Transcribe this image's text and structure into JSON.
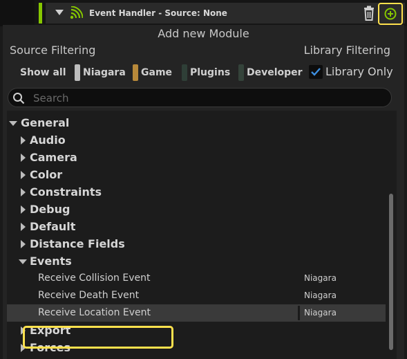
{
  "header": {
    "title": "Event Handler - Source: None",
    "accent_color": "#86c700",
    "highlight_color": "#ffe14d"
  },
  "panel": {
    "title": "Add new Module",
    "source_filtering_label": "Source Filtering",
    "library_filtering_label": "Library Filtering",
    "filters": {
      "show_all": "Show all",
      "niagara": "Niagara",
      "game": "Game",
      "plugins": "Plugins",
      "developer": "Developer"
    },
    "filter_colors": {
      "niagara": "#bdbdbd",
      "game": "#b8893a",
      "plugins": "#2f3f37",
      "developer": "#34433a"
    },
    "library_only": {
      "label": "Library Only",
      "checked": true
    },
    "search": {
      "placeholder": "Search",
      "value": ""
    }
  },
  "tree": {
    "root": "General",
    "categories": [
      "Audio",
      "Camera",
      "Color",
      "Constraints",
      "Debug",
      "Default",
      "Distance Fields",
      "Events"
    ],
    "events_items": [
      {
        "name": "Receive Collision Event",
        "source": "Niagara"
      },
      {
        "name": "Receive Death Event",
        "source": "Niagara"
      },
      {
        "name": "Receive Location Event",
        "source": "Niagara"
      }
    ],
    "after": [
      "Export",
      "Forces"
    ]
  }
}
